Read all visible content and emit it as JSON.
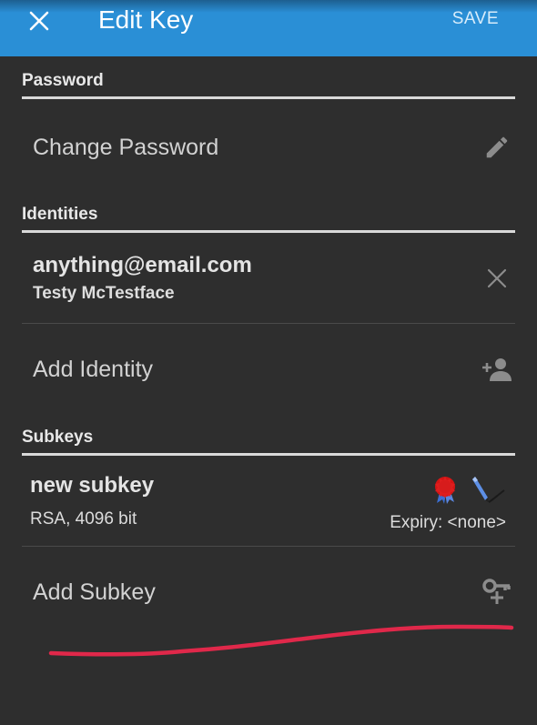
{
  "toolbar": {
    "title": "Edit Key",
    "save_label": "SAVE",
    "accent_color": "#2a8fd6"
  },
  "sections": {
    "password": {
      "header": "Password",
      "change_password_label": "Change Password",
      "icon": "pencil-icon"
    },
    "identities": {
      "header": "Identities",
      "items": [
        {
          "email": "anything@email.com",
          "name": "Testy McTestface",
          "icon": "close-icon"
        }
      ],
      "add_label": "Add Identity",
      "add_icon": "add-person-icon"
    },
    "subkeys": {
      "header": "Subkeys",
      "items": [
        {
          "name": "new subkey",
          "algorithm": "RSA, 4096 bit",
          "expiry": "Expiry: <none>",
          "icons": [
            "certify-seal-icon",
            "sign-pen-icon"
          ]
        }
      ],
      "add_label": "Add Subkey",
      "add_icon": "add-key-icon"
    }
  },
  "annotation": {
    "color": "#e0284a",
    "icon": "red-underline-stroke"
  }
}
